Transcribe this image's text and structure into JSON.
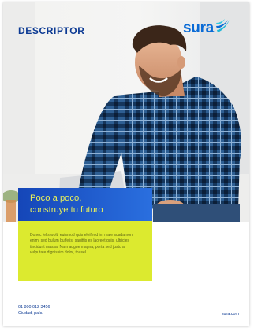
{
  "header": {
    "title": "DESCRIPTOR",
    "logo_text": "sura"
  },
  "banner": {
    "line1": "Poco a poco,",
    "line2": "construye tu futuro"
  },
  "body": {
    "text": "Donec felis wolt, euismod quis eleifend in, male suada non enim. sed bulum bu felis, sagittis es laoreet quis, ultricies tincidunt massa. Nam augue magna, porta sed justo a, vulputate dignissim dolor, thasel."
  },
  "footer": {
    "phone": "01 800 012 3456",
    "location": "Ciudad, país.",
    "website": "sura.com"
  },
  "colors": {
    "brand_blue": "#0c3a93",
    "logo_blue": "#0a6bd6",
    "banner_blue": "#1f5bd0",
    "accent_yellow": "#dcea2f",
    "tagline_yellow": "#e9f05a"
  },
  "icons": {
    "logo_mark": "sura-wing-logo-icon"
  }
}
